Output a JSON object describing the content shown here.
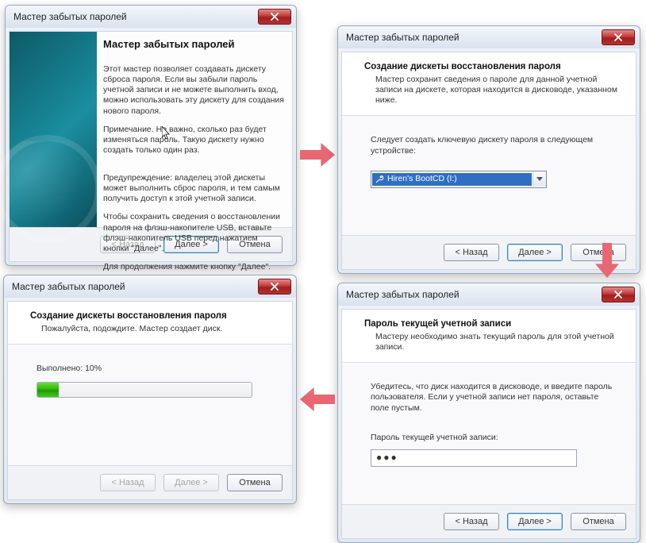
{
  "common": {
    "window_title": "Мастер забытых паролей",
    "back_label": "< Назад",
    "next_label": "Далее >",
    "cancel_label": "Отмена"
  },
  "step1": {
    "heading": "Мастер забытых паролей",
    "para1": "Этот мастер позволяет создавать дискету сброса пароля. Если вы забыли пароль учетной записи и не можете выполнить вход, можно использовать эту дискету для создания нового пароля.",
    "para2": "Примечание. Не важно, сколько раз будет изменяться пароль. Такую дискету нужно создать только один раз.",
    "para3": "Предупреждение: владелец этой дискеты может выполнить сброс пароля, и тем самым получить доступ к этой учетной записи.",
    "para4": "Чтобы сохранить сведения о восстановлении пароля на флэш-накопителе USB, вставьте флэш-накопитель USB перед нажатием кнопки \"Далее\".",
    "para5": "Для продолжения нажмите кнопку \"Далее\"."
  },
  "step2": {
    "header_title": "Создание дискеты восстановления пароля",
    "header_desc": "Мастер сохранит сведения о пароле для данной учетной записи на дискете, которая находится в дисководе, указанном ниже.",
    "body_text": "Следует создать ключевую дискету пароля в следующем устройстве:",
    "drive_label": "Hiren's BootCD (I:)"
  },
  "step3": {
    "header_title": "Пароль текущей учетной записи",
    "header_desc": "Мастеру необходимо знать текущий пароль для этой учетной записи.",
    "body_text": "Убедитесь, что диск находится в дисководе, и введите пароль пользователя. Если у учетной записи нет пароля, оставьте поле пустым.",
    "field_label": "Пароль текущей учетной записи:",
    "password_mask": "●●●"
  },
  "step4": {
    "header_title": "Создание дискеты восстановления пароля",
    "header_desc": "Пожалуйста, подождите. Мастер создает диск.",
    "progress_label": "Выполнено: 10%",
    "progress_percent": 10
  }
}
